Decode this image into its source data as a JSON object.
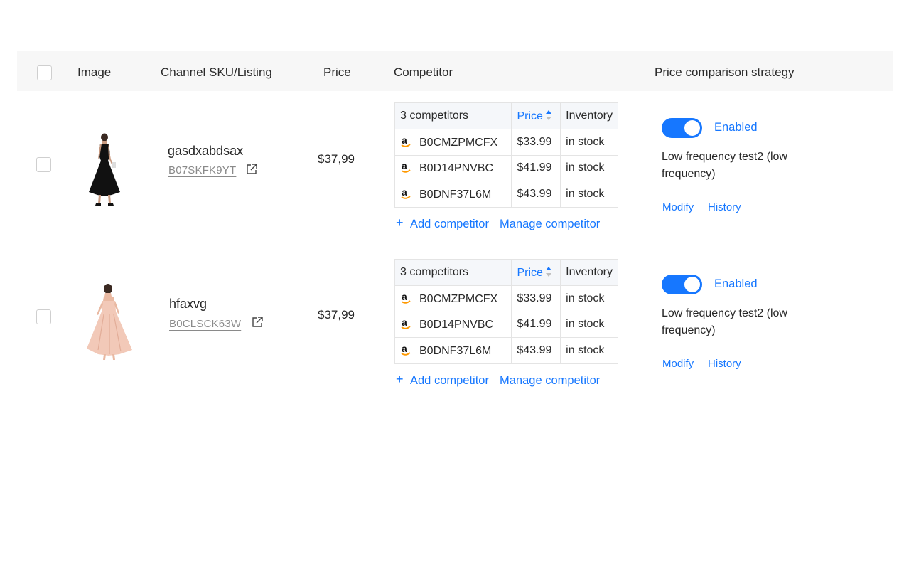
{
  "header": {
    "image": "Image",
    "sku": "Channel SKU/Listing",
    "price": "Price",
    "competitor": "Competitor",
    "strategy": "Price comparison strategy"
  },
  "rows": [
    {
      "name": "gasdxabdsax",
      "sku": "B07SKFK9YT",
      "price": "$37,99",
      "competitor_table": {
        "count_label": "3 competitors",
        "price_label": "Price",
        "inventory_label": "Inventory",
        "items": [
          {
            "asin": "B0CMZPMCFX",
            "price": "$33.99",
            "inventory": "in stock"
          },
          {
            "asin": "B0D14PNVBC",
            "price": "$41.99",
            "inventory": "in stock"
          },
          {
            "asin": "B0DNF37L6M",
            "price": "$43.99",
            "inventory": "in stock"
          }
        ]
      },
      "add_competitor": "Add competitor",
      "manage_competitor": "Manage competitor",
      "toggle_label": "Enabled",
      "toggle_on": true,
      "strategy_text": "Low frequency test2 (low frequency)",
      "modify": "Modify",
      "history": "History",
      "dress_color": "#111111"
    },
    {
      "name": "hfaxvg",
      "sku": "B0CLSCK63W",
      "price": "$37,99",
      "competitor_table": {
        "count_label": "3 competitors",
        "price_label": "Price",
        "inventory_label": "Inventory",
        "items": [
          {
            "asin": "B0CMZPMCFX",
            "price": "$33.99",
            "inventory": "in stock"
          },
          {
            "asin": "B0D14PNVBC",
            "price": "$41.99",
            "inventory": "in stock"
          },
          {
            "asin": "B0DNF37L6M",
            "price": "$43.99",
            "inventory": "in stock"
          }
        ]
      },
      "add_competitor": "Add competitor",
      "manage_competitor": "Manage competitor",
      "toggle_label": "Enabled",
      "toggle_on": true,
      "strategy_text": "Low frequency test2 (low frequency)",
      "modify": "Modify",
      "history": "History",
      "dress_color": "#f2c9b8"
    }
  ],
  "colors": {
    "accent": "#1677ff",
    "header_bg": "#f7f7f7"
  },
  "icons": {
    "external_link": "external-link-icon",
    "amazon": "amazon-logo-icon",
    "sort": "sort-icon"
  }
}
